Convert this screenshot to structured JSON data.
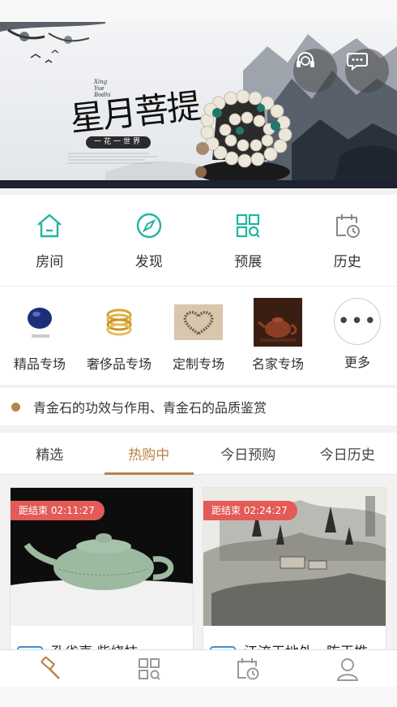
{
  "banner": {
    "title": "星月菩提",
    "tagline": "一花一世界",
    "colors": {
      "ink": "#1c2230",
      "bead": "#e9e4d6",
      "jade": "#1f7a6a"
    }
  },
  "nav": {
    "items": [
      {
        "label": "房间",
        "icon": "house-icon"
      },
      {
        "label": "发现",
        "icon": "compass-icon"
      },
      {
        "label": "预展",
        "icon": "grid-search-icon"
      },
      {
        "label": "历史",
        "icon": "calendar-clock-icon"
      }
    ],
    "icon_color": "#1fb5a0"
  },
  "categories": [
    {
      "label": "精品专场"
    },
    {
      "label": "奢侈品专场"
    },
    {
      "label": "定制专场"
    },
    {
      "label": "名家专场"
    },
    {
      "label": "更多"
    }
  ],
  "notice": {
    "text": "青金石的功效与作用、青金石的品质鉴赏",
    "dot_color": "#b68447"
  },
  "tabs": [
    {
      "label": "精选",
      "active": false
    },
    {
      "label": "热购中",
      "active": true
    },
    {
      "label": "今日预购",
      "active": false
    },
    {
      "label": "今日历史",
      "active": false
    }
  ],
  "accent_color": "#b68447",
  "cards": [
    {
      "countdown": "距结束 02:11:27",
      "title": "孔雀壶 柴烧技"
    },
    {
      "countdown": "距结束 02:24:27",
      "title": "江流天地外，陈玉樵"
    }
  ],
  "countdown_color": "#e35a56",
  "tabbar": {
    "items": [
      {
        "icon": "auction-hammer-icon",
        "active": true
      },
      {
        "icon": "grid-search-icon",
        "active": false
      },
      {
        "icon": "calendar-clock-icon",
        "active": false
      },
      {
        "icon": "user-icon",
        "active": false
      }
    ]
  }
}
